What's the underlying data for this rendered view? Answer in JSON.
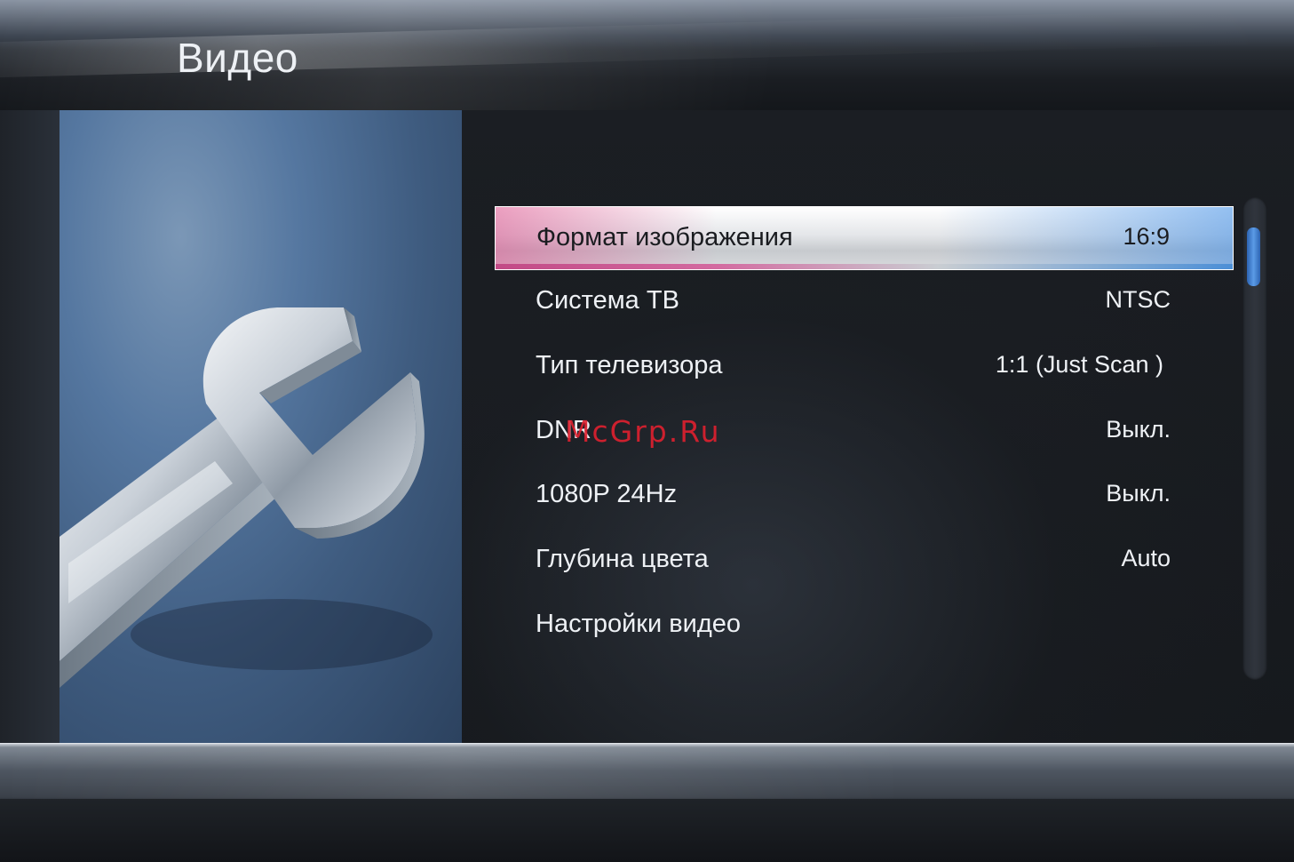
{
  "header": {
    "title": "Видео"
  },
  "menu": {
    "items": [
      {
        "label": "Формат изображения",
        "value": "16:9",
        "selected": true
      },
      {
        "label": "Система ТВ",
        "value": "NTSC",
        "selected": false
      },
      {
        "label": "Тип телевизора",
        "value": "1:1 (Just Scan )",
        "selected": false
      },
      {
        "label": "DNR",
        "value": "Выкл.",
        "selected": false
      },
      {
        "label": "1080P 24Hz",
        "value": "Выкл.",
        "selected": false
      },
      {
        "label": "Глубина цвета",
        "value": "Auto",
        "selected": false
      },
      {
        "label": "Настройки видео",
        "value": "",
        "selected": false
      }
    ]
  },
  "scrollbar": {
    "thumb_color": "#5b9be6"
  },
  "watermark": "McGrp.Ru",
  "icons": {
    "illustration": "wrench-icon"
  },
  "colors": {
    "highlight_start": "#c24a86",
    "highlight_end": "#4c8fd6",
    "panel_blue": "#5577a0"
  }
}
